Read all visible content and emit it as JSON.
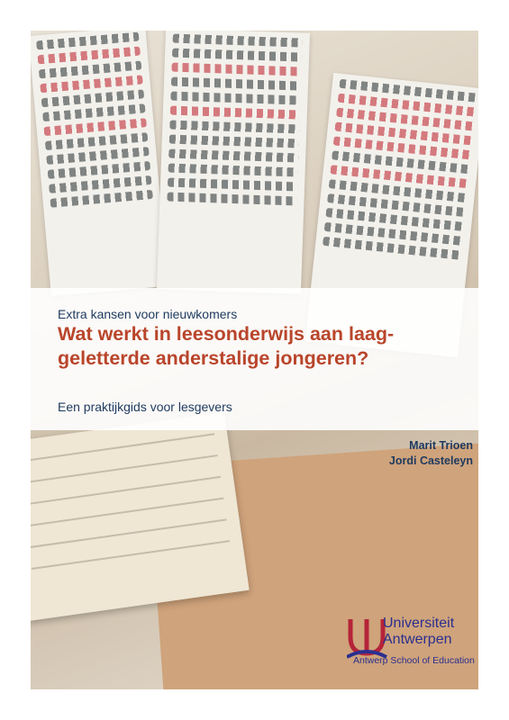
{
  "cover": {
    "series_title": "Extra kansen voor nieuwkomers",
    "title": "Wat werkt in leesonderwijs aan laag-geletterde anderstalige jongeren?",
    "subtitle": "Een praktijkgids voor lesgevers",
    "authors": [
      "Marit Trioen",
      "Jordi Casteleyn"
    ]
  },
  "logo": {
    "line1": "Universiteit",
    "line2": "Antwerpen",
    "school": "Antwerp School of Education",
    "colors": {
      "red": "#b52438",
      "blue": "#2b2f8f"
    }
  },
  "colors": {
    "title": "#b9452b",
    "text": "#1e3a5f"
  }
}
